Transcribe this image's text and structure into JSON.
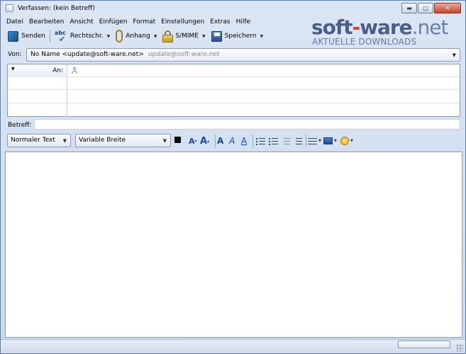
{
  "window": {
    "title": "Verfassen: (kein Betreff)"
  },
  "menu": {
    "items": [
      {
        "label": "Datei"
      },
      {
        "label": "Bearbeiten"
      },
      {
        "label": "Ansicht"
      },
      {
        "label": "Einfügen"
      },
      {
        "label": "Format"
      },
      {
        "label": "Einstellungen"
      },
      {
        "label": "Extras"
      },
      {
        "label": "Hilfe"
      }
    ]
  },
  "toolbar": {
    "send": "Senden",
    "spell": "Rechtschr.",
    "spell_icon_text": "abc",
    "attach": "Anhang",
    "smime": "S/MIME",
    "save": "Speichern"
  },
  "logo": {
    "main_a": "soft",
    "main_b": "ware",
    "main_c": ".net",
    "sub": "AKTUELLE DOWNLOADS"
  },
  "from": {
    "label": "Von:",
    "value": "No Name <update@soft-ware.net>",
    "account": "update@soft-ware.net"
  },
  "recipients": {
    "rows": [
      {
        "type": "An:"
      },
      {
        "type": ""
      },
      {
        "type": ""
      },
      {
        "type": ""
      }
    ]
  },
  "subject": {
    "label": "Betreff:",
    "value": ""
  },
  "format": {
    "paragraph": "Normaler Text",
    "font": "Variable Breite"
  },
  "colors": {
    "accent": "#1e4a9c",
    "window_bg": "#cfdcef"
  },
  "icons": {
    "send": "send-icon",
    "spell": "spellcheck-icon",
    "attach": "paperclip-icon",
    "smime": "lock-icon",
    "save": "save-icon",
    "recipient": "person-icon"
  }
}
